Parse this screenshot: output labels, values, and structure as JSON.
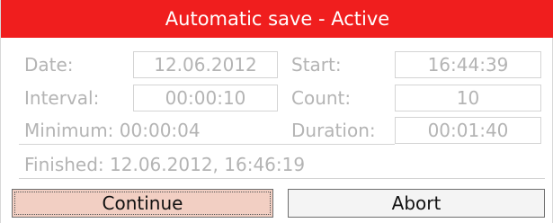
{
  "window": {
    "title": "Automatic save - Active"
  },
  "fields": {
    "date": {
      "label": "Date:",
      "value": "12.06.2012"
    },
    "start": {
      "label": "Start:",
      "value": "16:44:39"
    },
    "interval": {
      "label": "Interval:",
      "value": "00:00:10"
    },
    "count": {
      "label": "Count:",
      "value": "10"
    },
    "minimum": {
      "label": "Minimum:",
      "value": "00:00:04"
    },
    "duration": {
      "label": "Duration:",
      "value": "00:01:40"
    }
  },
  "status": {
    "finished": "Finished: 12.06.2012, 16:46:19"
  },
  "buttons": {
    "continue_label": "Continue",
    "abort_label": "Abort"
  },
  "colors": {
    "titlebar": "#f01e1e",
    "continue_bg": "#f2cfc3",
    "disabled_text": "#b4b4b4"
  }
}
